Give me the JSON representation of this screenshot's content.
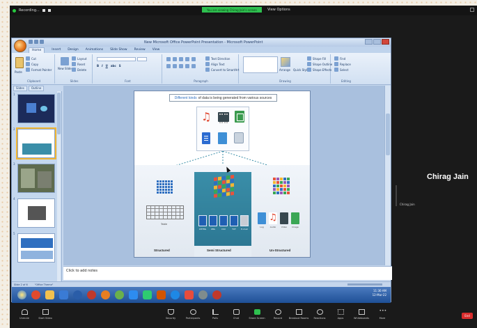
{
  "meeting": {
    "recording_label": "Recording...",
    "share_banner": "You are viewing Chirag Jain's screen",
    "view_options": "View Options"
  },
  "ppt": {
    "window_title": "New Microsoft Office PowerPoint Presentation - Microsoft PowerPoint",
    "tabs": [
      "Home",
      "Insert",
      "Design",
      "Animations",
      "Slide Show",
      "Review",
      "View"
    ],
    "ribbon": {
      "clipboard": {
        "label": "Clipboard",
        "paste": "Paste",
        "cut": "Cut",
        "copy": "Copy",
        "format_painter": "Format Painter"
      },
      "slides": {
        "label": "Slides",
        "new_slide": "New Slide",
        "layout": "Layout",
        "reset": "Reset",
        "delete": "Delete"
      },
      "font": {
        "label": "Font"
      },
      "paragraph": {
        "label": "Paragraph",
        "text_direction": "Text Direction",
        "align_text": "Align Text",
        "convert_smartart": "Convert to SmartArt"
      },
      "drawing": {
        "label": "Drawing",
        "arrange": "Arrange",
        "quick_styles": "Quick Styles",
        "shape_fill": "Shape Fill",
        "shape_outline": "Shape Outline",
        "shape_effects": "Shape Effects"
      },
      "editing": {
        "label": "Editing",
        "find": "Find",
        "replace": "Replace",
        "select": "Select"
      }
    },
    "pane_tabs": [
      "Slides",
      "Outline"
    ],
    "slide_numbers": [
      "1",
      "2",
      "3",
      "4",
      "5"
    ],
    "slide": {
      "title_highlight": "Different kinds",
      "title_rest": "of data is being generated from various sources",
      "structured_label": "Structured",
      "semi_label": "Semi Structured",
      "unstructured_label": "Un-Structured",
      "table_label": "Table",
      "semi_file_labels": [
        "XHTML",
        "XML",
        "CSV",
        "TXT",
        "E-mail"
      ],
      "unstr_file_labels": [
        "Log",
        "Audio",
        "Video",
        "Image"
      ]
    },
    "notes_placeholder": "Click to add notes",
    "status": {
      "slide_of": "Slide 2 of 6",
      "theme": "\"Office Theme\""
    },
    "clock": {
      "time": "11:30 AM",
      "date": "12-Mar-22"
    }
  },
  "participant": {
    "name": "Chirag Jain",
    "tag": "Chirag Jain"
  },
  "toolbar": {
    "items": [
      "Unmute",
      "Start Video",
      "Security",
      "Participants",
      "Polls",
      "Chat",
      "Share Screen",
      "Record",
      "Breakout Rooms",
      "Reactions",
      "Apps",
      "Whiteboards",
      "More"
    ],
    "participants_count": "125",
    "end_label": "End"
  },
  "colors": {
    "zoom_bg": "#1a1a1a",
    "ribbon_blue": "#c7d8ee",
    "semi_panel": "#3a8ea8",
    "share_green": "#2ec04f",
    "end_red": "#d92d2d"
  }
}
